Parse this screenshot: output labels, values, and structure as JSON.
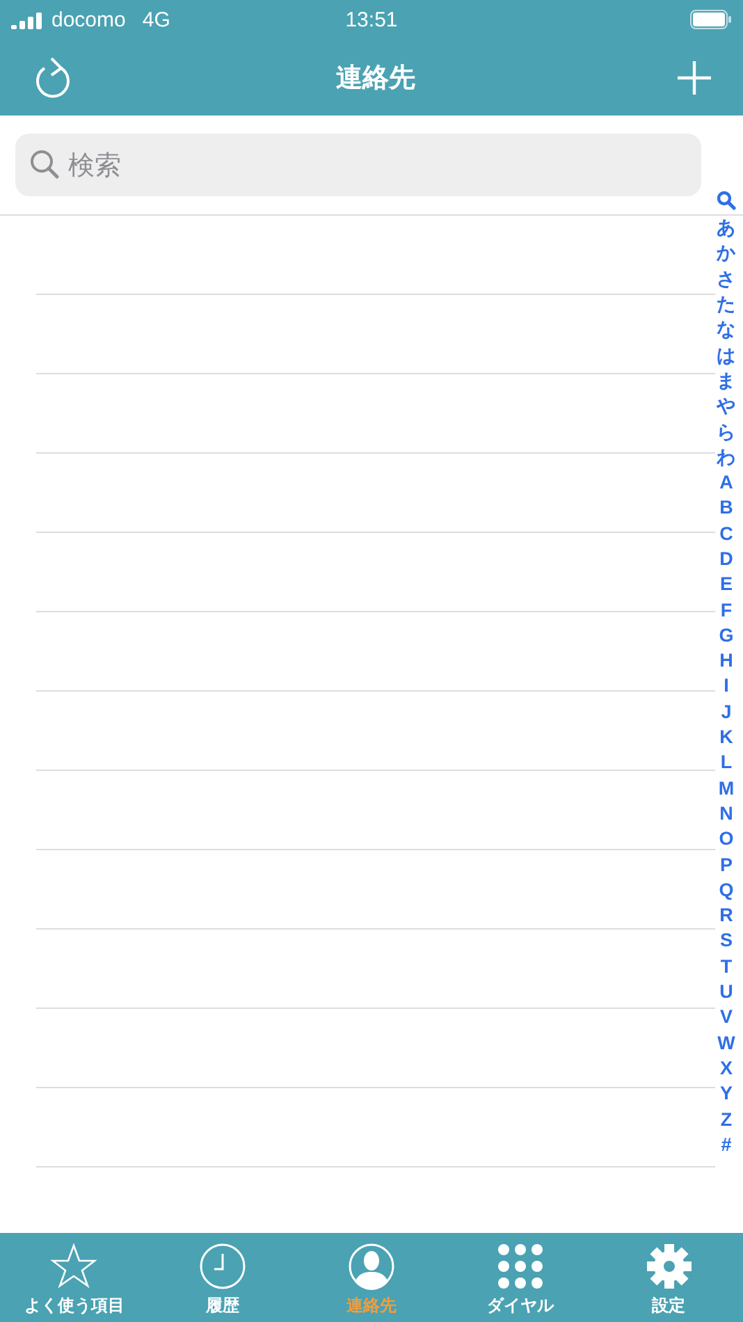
{
  "status_bar": {
    "carrier": "docomo",
    "network": "4G",
    "time": "13:51"
  },
  "nav": {
    "title": "連絡先"
  },
  "search": {
    "placeholder": "検索"
  },
  "index": [
    "あ",
    "か",
    "さ",
    "た",
    "な",
    "は",
    "ま",
    "や",
    "ら",
    "わ",
    "A",
    "B",
    "C",
    "D",
    "E",
    "F",
    "G",
    "H",
    "I",
    "J",
    "K",
    "L",
    "M",
    "N",
    "O",
    "P",
    "Q",
    "R",
    "S",
    "T",
    "U",
    "V",
    "W",
    "X",
    "Y",
    "Z",
    "#"
  ],
  "tabs": [
    {
      "kind": "star",
      "label": "よく使う項目",
      "selected": false
    },
    {
      "kind": "clock",
      "label": "履歴",
      "selected": false
    },
    {
      "kind": "person",
      "label": "連絡先",
      "selected": true
    },
    {
      "kind": "dialpad",
      "label": "ダイヤル",
      "selected": false
    },
    {
      "kind": "gear",
      "label": "設定",
      "selected": false
    }
  ]
}
